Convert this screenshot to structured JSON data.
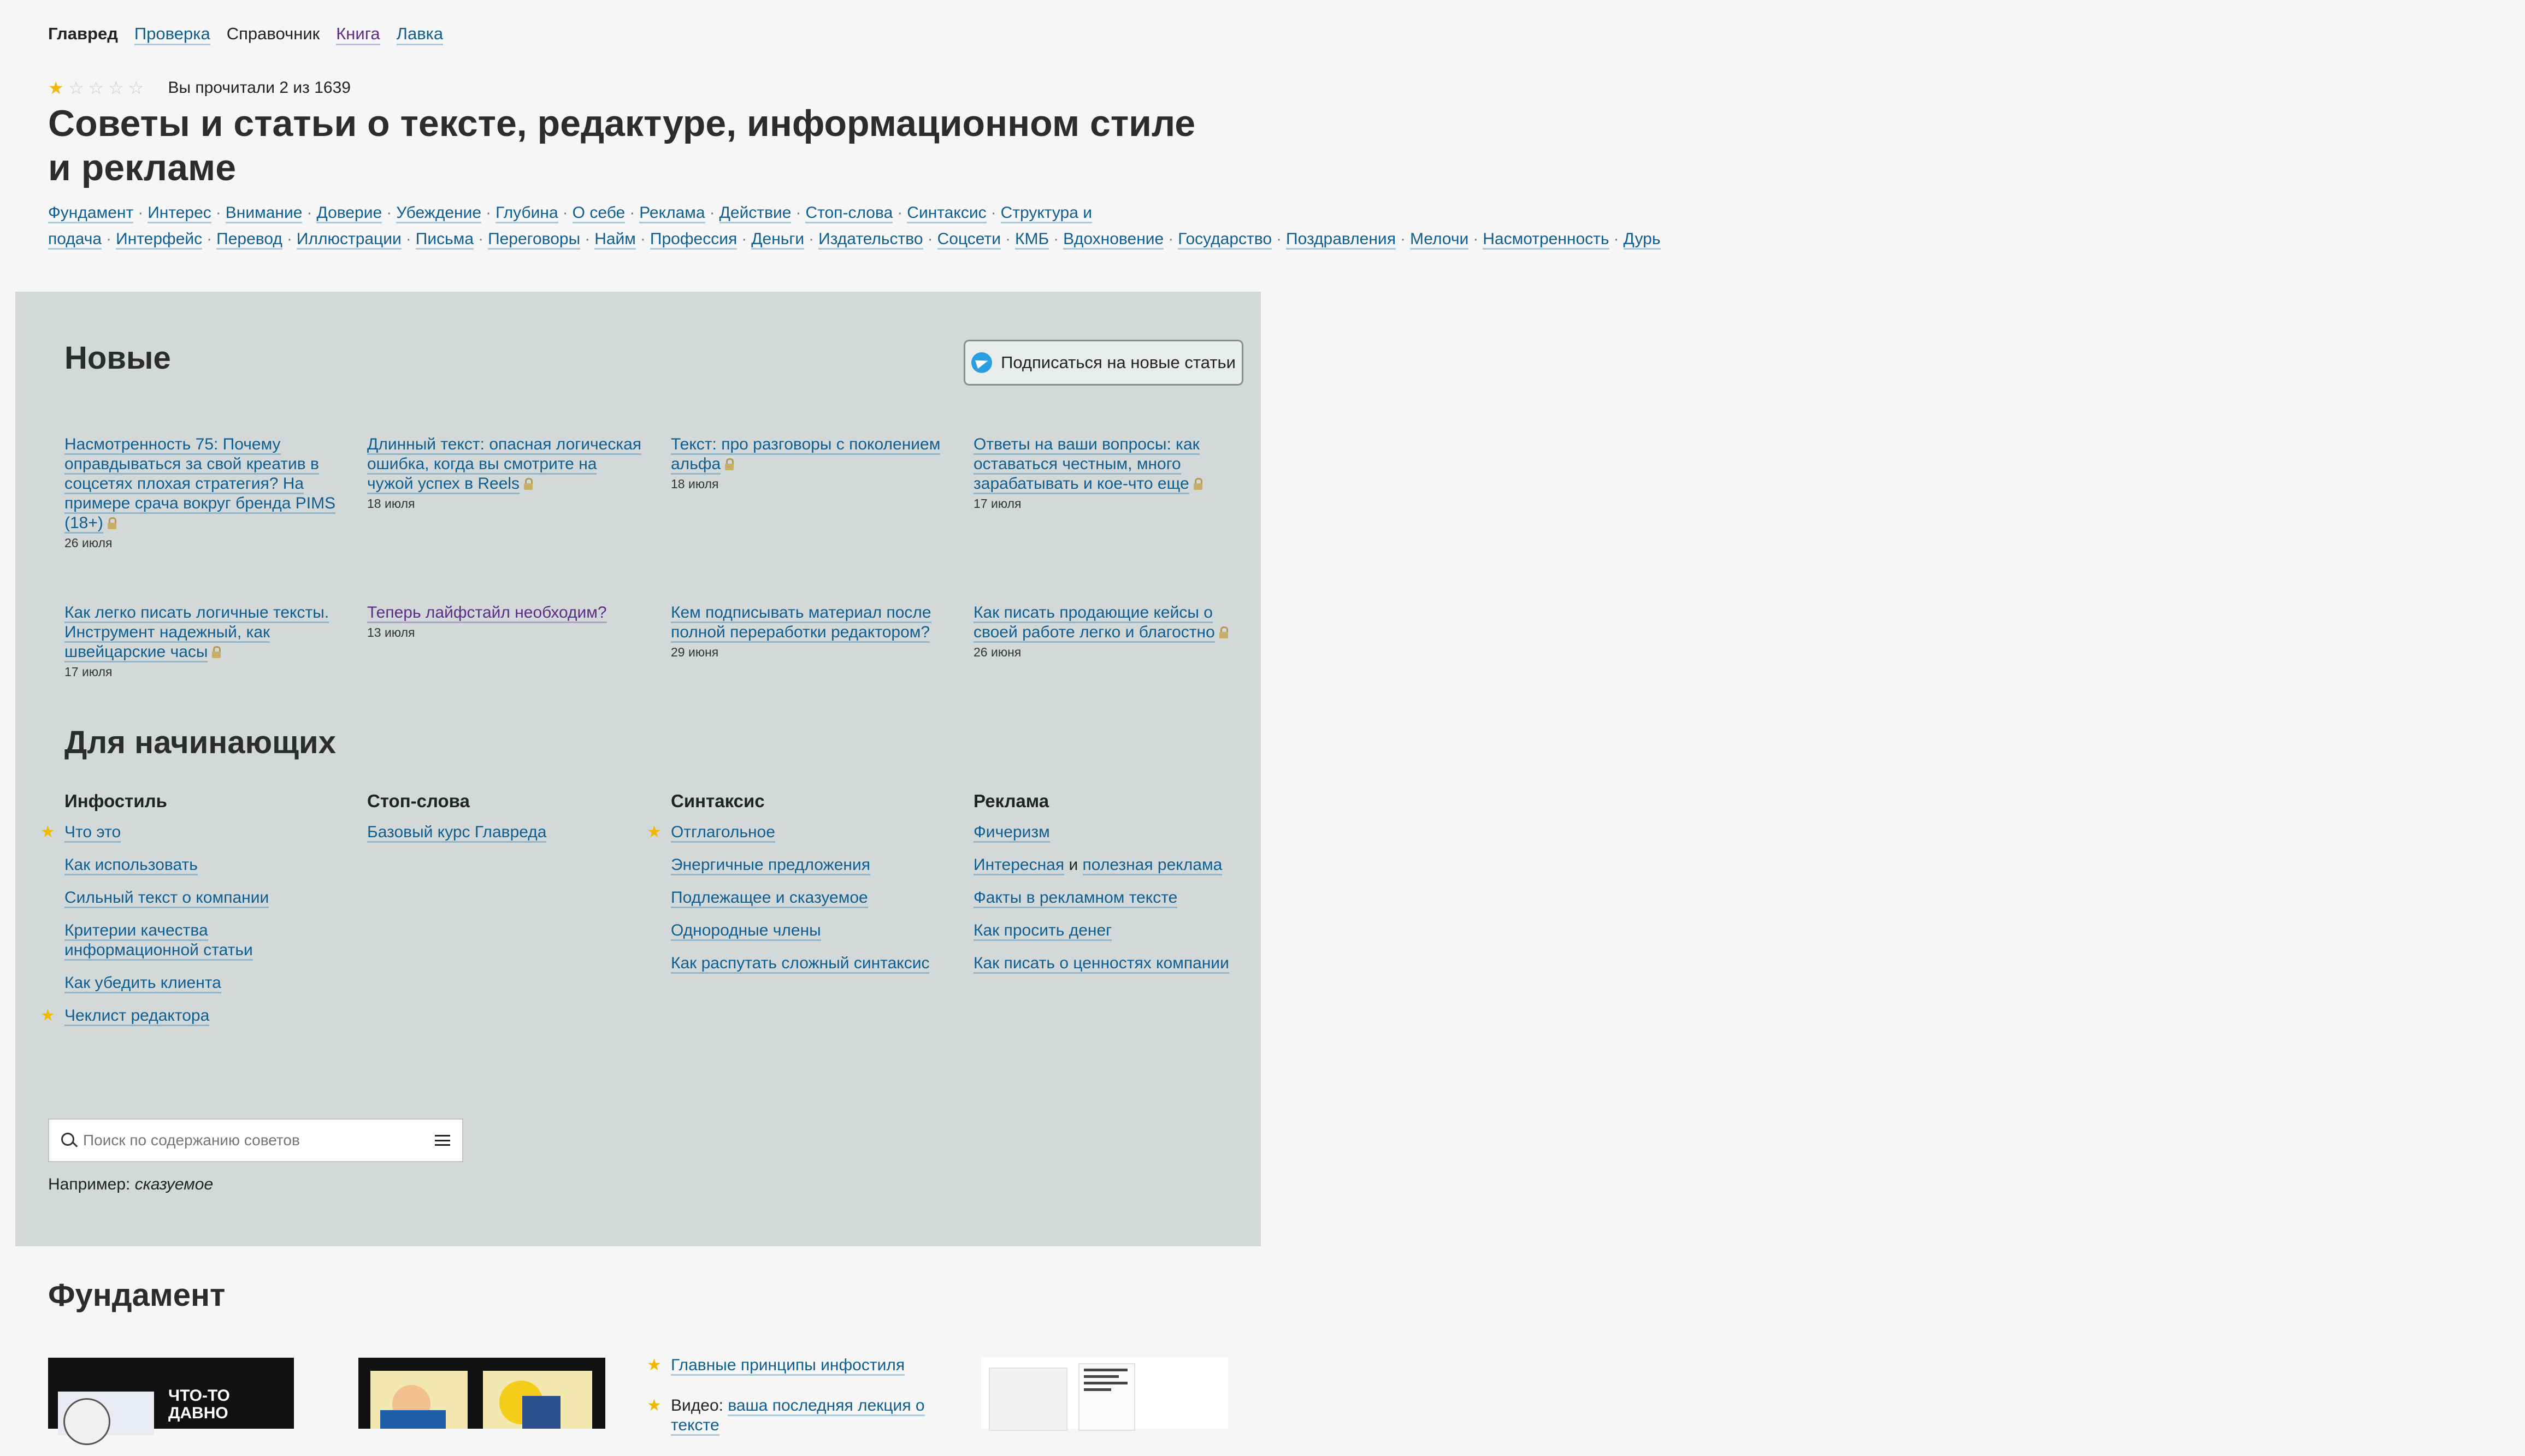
{
  "nav": {
    "items": [
      {
        "label": "Главред",
        "current": true
      },
      {
        "label": "Проверка"
      },
      {
        "label": "Справочник",
        "plain": true
      },
      {
        "label": "Книга",
        "visited": true
      },
      {
        "label": "Лавка"
      }
    ]
  },
  "rating": {
    "stars_filled": 1,
    "stars_total": 5,
    "progress_text": "Вы прочитали 2 из 1639"
  },
  "title": "Советы и статьи о тексте, редактуре, информационном стиле и рекламе",
  "tags": [
    "Фундамент",
    "Интерес",
    "Внимание",
    "Доверие",
    "Убеждение",
    "Глубина",
    "О себе",
    "Реклама",
    "Действие",
    "Стоп-слова",
    "Синтаксис",
    "Структура и подача",
    "Интерфейс",
    "Перевод",
    "Иллюстрации",
    "Письма",
    "Переговоры",
    "Найм",
    "Профессия",
    "Деньги",
    "Издательство",
    "Соцсети",
    "КМБ",
    "Вдохновение",
    "Государство",
    "Поздравления",
    "Мелочи",
    "Насмотренность",
    "Дурь"
  ],
  "new_section": {
    "heading": "Новые",
    "subscribe_label": "Подписаться на новые статьи",
    "articles": [
      {
        "title": "Насмотренность 75: Почему оправдываться за свой креатив в соцсетях плохая стратегия? На примере срача вокруг бренда PIMS (18+)",
        "date": "26 июля",
        "locked": true
      },
      {
        "title": "Длинный текст: опасная логическая ошибка, когда вы смотрите на чужой успех в Reels",
        "date": "18 июля",
        "locked": true
      },
      {
        "title": "Текст: про разговоры с поколением альфа",
        "date": "18 июля",
        "locked": true
      },
      {
        "title": "Ответы на ваши вопросы: как оставаться честным, много зарабатывать и кое-что еще",
        "date": "17 июля",
        "locked": true
      },
      {
        "title": "Как легко писать логичные тексты. Инструмент надежный, как швейцарские часы",
        "date": "17 июля",
        "locked": true
      },
      {
        "title": "Теперь лайфстайл необходим?",
        "date": "13 июля",
        "locked": false,
        "visited": true
      },
      {
        "title": "Кем подписывать материал после полной переработки редактором?",
        "date": "29 июня",
        "locked": false
      },
      {
        "title": "Как писать продающие кейсы о своей работе легко и благостно",
        "date": "26 июня",
        "locked": true
      }
    ]
  },
  "beginners": {
    "heading": "Для начинающих",
    "columns": [
      {
        "title": "Инфостиль",
        "items": [
          {
            "label": "Что это",
            "starred": true
          },
          {
            "label": "Как использовать"
          },
          {
            "label": "Сильный текст о компании"
          },
          {
            "label": "Критерии качества информационной статьи"
          },
          {
            "label": "Как убедить клиента"
          },
          {
            "label": "Чеклист редактора",
            "starred": true
          }
        ]
      },
      {
        "title": "Стоп-слова",
        "items": [
          {
            "label": "Базовый курс Главреда"
          }
        ]
      },
      {
        "title": "Синтаксис",
        "items": [
          {
            "label": "Отглагольное",
            "starred": true
          },
          {
            "label": "Энергичные предложения"
          },
          {
            "label": "Подлежащее и сказуемое"
          },
          {
            "label": "Однородные члены"
          },
          {
            "label": "Как распутать сложный синтаксис"
          }
        ]
      },
      {
        "title": "Реклама",
        "items": [
          {
            "label": "Фичеризм"
          },
          {
            "label": "Интересная",
            "joiner": "и",
            "label2": "полезная реклама"
          },
          {
            "label": "Факты в рекламном тексте"
          },
          {
            "label": "Как просить денег"
          },
          {
            "label": "Как писать о ценностях компании"
          }
        ]
      }
    ]
  },
  "search": {
    "placeholder": "Поиск по содержанию советов",
    "example_prefix": "Например:",
    "example_word": "сказуемое"
  },
  "fundament": {
    "heading": "Фундамент",
    "thumb1_text": "ЧТО-ТО ДАВНО",
    "links": [
      {
        "label": "Главные принципы инфостиля",
        "starred": true
      },
      {
        "prefix": "Видео:",
        "label": "ваша последняя лекция о тексте",
        "starred": true
      }
    ]
  },
  "colors": {
    "link": "#0f5e8f",
    "visited": "#5b2d86",
    "panel_bg": "#d3d9d9",
    "star": "#f2b705",
    "page_bg": "#f6f6f6"
  }
}
